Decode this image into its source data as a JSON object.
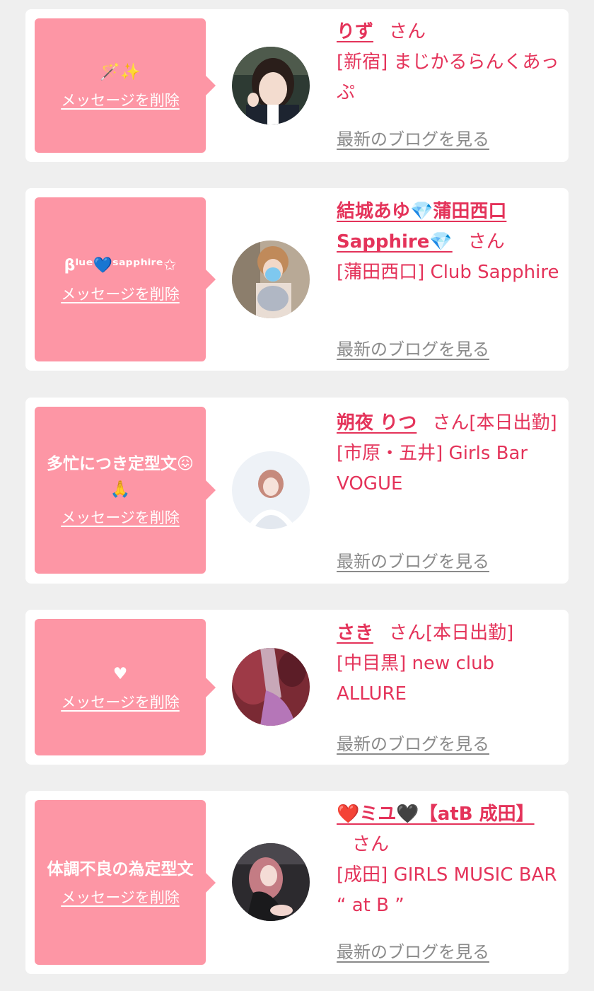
{
  "entries": [
    {
      "message": "🪄✨",
      "delete_label": "メッセージを削除",
      "name": "りず",
      "san": "さん",
      "status": "",
      "area_shop": "[新宿] まじかるらんくあっぷ",
      "blog_label": "最新のブログを見る",
      "avatar_icon": "avatar-photo-1"
    },
    {
      "message": "βˡᵘᵉ💙ˢᵃᵖᵖʰⁱʳᵉ✩",
      "delete_label": "メッセージを削除",
      "name": "結城あゆ💎蒲田西口Sapphire💎",
      "san": "さん",
      "status": "",
      "area_shop": "[蒲田西口] Club Sapphire",
      "blog_label": "最新のブログを見る",
      "avatar_icon": "avatar-photo-2"
    },
    {
      "message": "多忙につき定型文😖🙏",
      "delete_label": "メッセージを削除",
      "name": "朔夜 りつ",
      "san": "さん",
      "status": "[本日出勤]",
      "area_shop": "[市原・五井] Girls Bar VOGUE",
      "blog_label": "最新のブログを見る",
      "avatar_icon": "avatar-photo-3"
    },
    {
      "message": "♥",
      "delete_label": "メッセージを削除",
      "name": "さき",
      "san": "さん",
      "status": "[本日出勤]",
      "area_shop": "[中目黒] new club ALLURE",
      "blog_label": "最新のブログを見る",
      "avatar_icon": "avatar-photo-4"
    },
    {
      "message": "体調不良の為定型文",
      "delete_label": "メッセージを削除",
      "name": "❤️ミユ🖤【atB 成田】",
      "san": "さん",
      "status": "",
      "area_shop": "[成田] GIRLS MUSIC BAR “ at B ”",
      "blog_label": "最新のブログを見る",
      "avatar_icon": "avatar-photo-5"
    }
  ],
  "colors": {
    "bubble": "#fd96a5",
    "name_text": "#e4335a",
    "blog_link": "#8a8a8a",
    "background": "#efefef"
  }
}
